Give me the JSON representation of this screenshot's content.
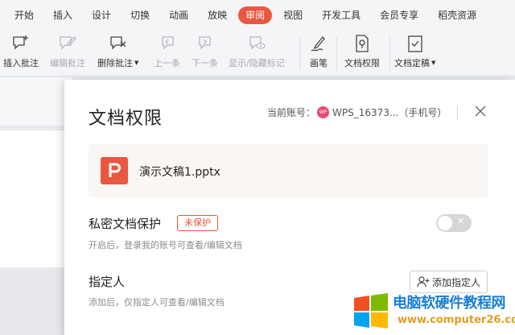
{
  "ribbon": {
    "tabs": [
      "开始",
      "插入",
      "设计",
      "切换",
      "动画",
      "放映",
      "审阅",
      "视图",
      "开发工具",
      "会员专享",
      "稻壳资源"
    ],
    "active_tab": "审阅"
  },
  "toolbar": {
    "insert_comment": "插入批注",
    "edit_comment": "编辑批注",
    "delete_comment": "删除批注",
    "prev": "上一条",
    "next": "下一条",
    "show_hide": "显示/隐藏标记",
    "pen": "画笔",
    "doc_permission": "文档权限",
    "doc_finalize": "文档定稿"
  },
  "dialog": {
    "title": "文档权限",
    "account_label": "当前账号：",
    "avatar_text": "WP",
    "account_name": "WPS_16373...（手机号）",
    "file_name": "演示文稿1.pptx",
    "private_title": "私密文档保护",
    "private_status": "未保护",
    "private_desc": "开启后，登录我的账号可查看/编辑文档",
    "designee_title": "指定人",
    "designee_desc": "添加后，仅指定人可查看/编辑文档",
    "add_designee_button": "添加指定人"
  },
  "watermark": {
    "name": "电脑软硬件教程网",
    "url": "www.computer26.com"
  },
  "colors": {
    "accent": "#e9573f",
    "watermark_blue": "#1b7fd1"
  }
}
